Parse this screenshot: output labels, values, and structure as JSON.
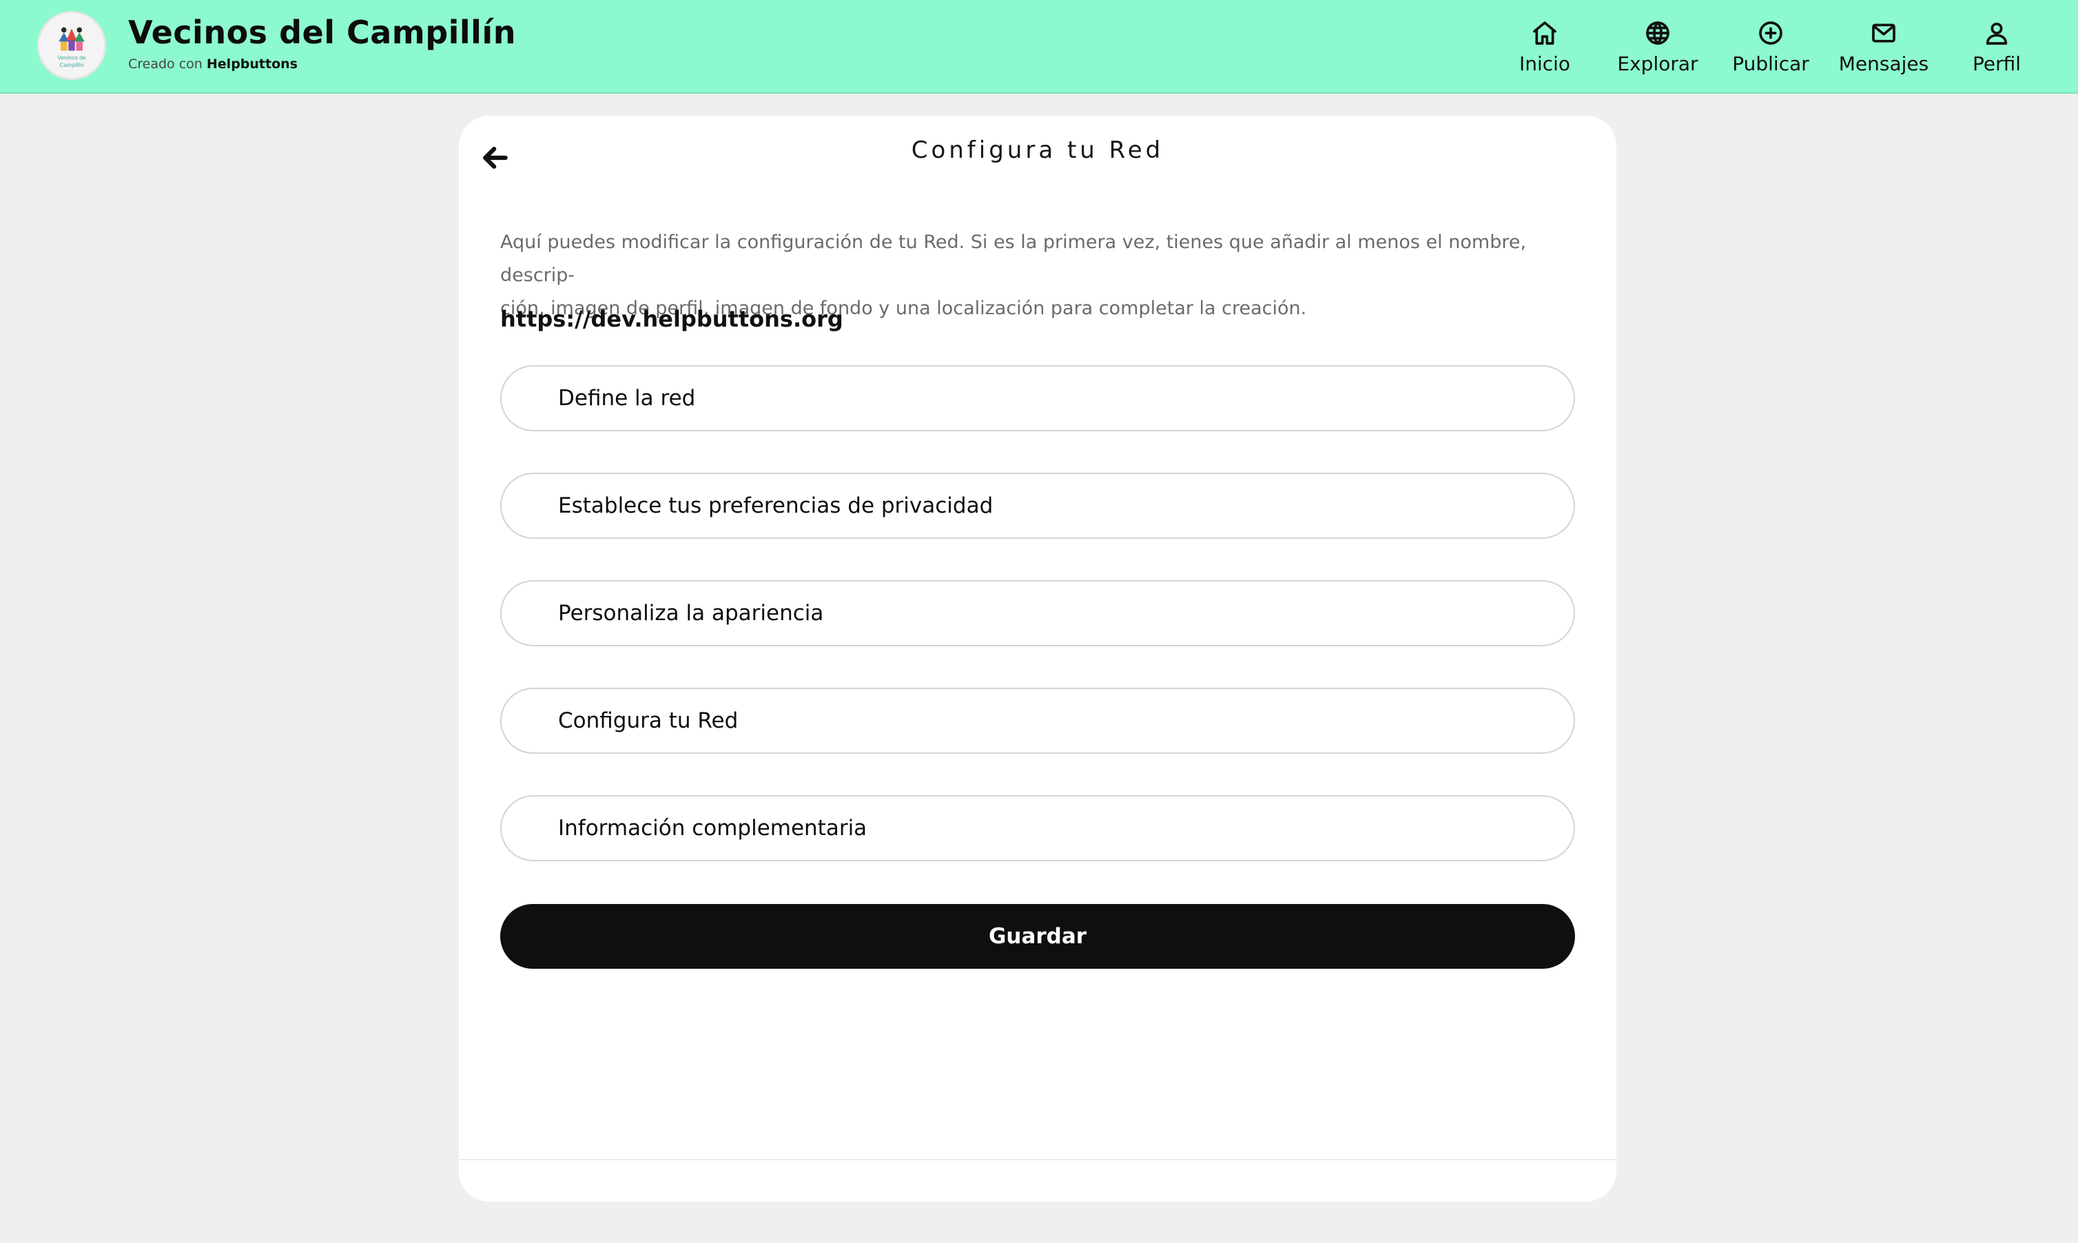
{
  "header": {
    "title": "Vecinos del Campillín",
    "subtitle_prefix": "Creado con",
    "subtitle_brand": "Helpbuttons",
    "logo_text_1": "Vecinos de",
    "logo_text_2": "Campillín",
    "background_color": "#8cf9cf"
  },
  "nav": {
    "items": [
      {
        "label": "Inicio",
        "icon": "home-icon"
      },
      {
        "label": "Explorar",
        "icon": "globe-icon"
      },
      {
        "label": "Publicar",
        "icon": "plus-circle-icon"
      },
      {
        "label": "Mensajes",
        "icon": "mail-icon"
      },
      {
        "label": "Perfil",
        "icon": "user-icon"
      }
    ]
  },
  "page": {
    "title": "Configura tu Red",
    "intro_line_1": "Aquí puedes modificar la configuración de tu Red. Si es la primera vez, tienes que añadir al menos el nombre, descrip-",
    "intro_line_2": "ción, imagen de perfil, imagen de fondo y una localización para completar la creación.",
    "url": "https://dev.helpbuttons.org",
    "sections": [
      {
        "label": "Define la red"
      },
      {
        "label": "Establece tus preferencias de privacidad"
      },
      {
        "label": "Personaliza la apariencia"
      },
      {
        "label": "Configura tu Red"
      },
      {
        "label": "Información complementaria"
      }
    ],
    "save_label": "Guardar"
  }
}
